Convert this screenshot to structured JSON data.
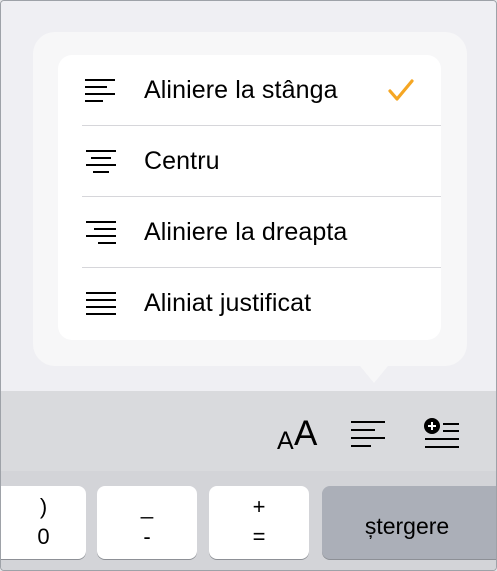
{
  "menu": {
    "items": [
      {
        "label": "Aliniere la stânga",
        "icon": "align-left-icon",
        "checked": true
      },
      {
        "label": "Centru",
        "icon": "align-center-icon",
        "checked": false
      },
      {
        "label": "Aliniere la dreapta",
        "icon": "align-right-icon",
        "checked": false
      },
      {
        "label": "Aliniat justificat",
        "icon": "align-justify-icon",
        "checked": false
      }
    ]
  },
  "toolbar": {
    "font_size_small": "A",
    "font_size_big": "A",
    "buttons": [
      "text-size-icon",
      "align-left-icon",
      "insert-list-icon"
    ]
  },
  "keyboard": {
    "keys": [
      {
        "top": ")",
        "bottom": "0"
      },
      {
        "top": "_",
        "bottom": "-"
      },
      {
        "top": "+",
        "bottom": "="
      }
    ],
    "delete_label": "ștergere"
  },
  "colors": {
    "accent": "#f5a623",
    "background": "#efeff3",
    "keyboard": "#d3d4d8"
  }
}
